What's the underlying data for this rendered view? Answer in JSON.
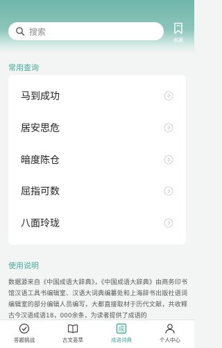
{
  "search": {
    "placeholder": "搜索"
  },
  "favorites": {
    "label": "收藏"
  },
  "common": {
    "title": "常用查询",
    "items": [
      {
        "label": "马到成功"
      },
      {
        "label": "居安思危"
      },
      {
        "label": "暗度陈仓"
      },
      {
        "label": "屈指可数"
      },
      {
        "label": "八面玲珑"
      }
    ]
  },
  "usage": {
    "title": "使用说明",
    "text": "数据源来自《中国成语大辞典》，《中国成语大辞典》由商务印书馆汉语工具书编辑室、汉语大词典编纂处和上海辞书出版社语词编辑室的部分编辑人员编写，大都直接取材于历代文献，共收释古今汉语成语18，000余条，为读者提供了成语的"
  },
  "tabs": [
    {
      "label": "答题挑战",
      "icon": "check-circle-icon"
    },
    {
      "label": "古文荟萃",
      "icon": "open-book-icon"
    },
    {
      "label": "成语词典",
      "icon": "dictionary-icon",
      "badge": "成"
    },
    {
      "label": "个人中心",
      "icon": "person-icon"
    }
  ],
  "colors": {
    "accent": "#45a89a",
    "header": "#6fb6aa"
  }
}
